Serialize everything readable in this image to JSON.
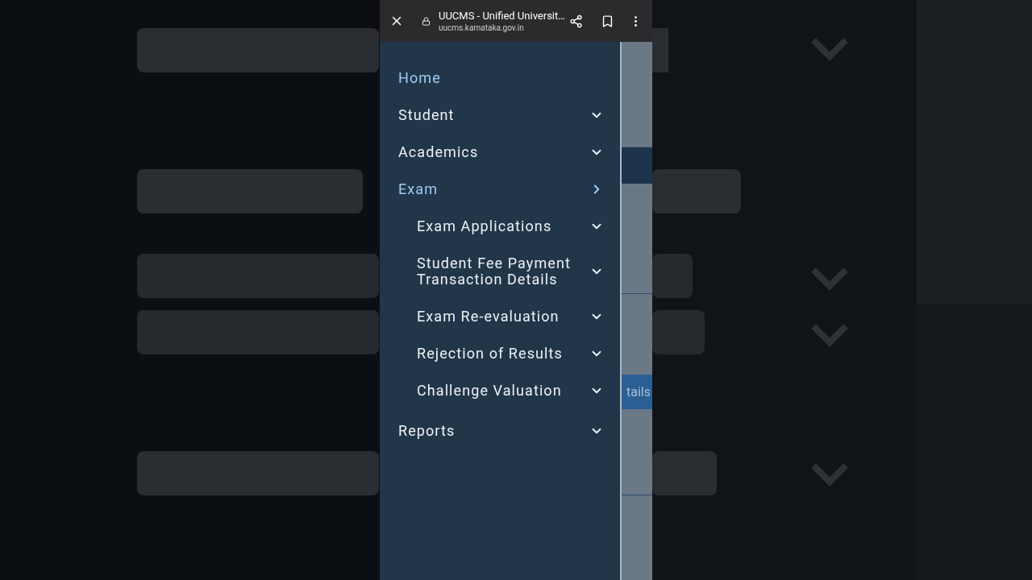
{
  "browser_bar": {
    "title": "UUCMS - Unified Universit…",
    "url": "uucms.karnataka.gov.in"
  },
  "menu": [
    {
      "label": "Home",
      "selected": true,
      "has_submenu": false,
      "expanded": false
    },
    {
      "label": "Student",
      "selected": false,
      "has_submenu": true,
      "expanded": false
    },
    {
      "label": "Academics",
      "selected": false,
      "has_submenu": true,
      "expanded": false
    },
    {
      "label": "Exam",
      "selected": true,
      "has_submenu": true,
      "expanded": true,
      "children": [
        {
          "label": "Exam Applications",
          "selected": false,
          "has_submenu": true,
          "expanded": false
        },
        {
          "label": "Student Fee Payment Transaction Details",
          "selected": false,
          "has_submenu": true,
          "expanded": false
        },
        {
          "label": "Exam Re-evaluation",
          "selected": false,
          "has_submenu": true,
          "expanded": false
        },
        {
          "label": "Rejection of Results",
          "selected": false,
          "has_submenu": true,
          "expanded": false
        },
        {
          "label": "Challenge Valuation",
          "selected": false,
          "has_submenu": true,
          "expanded": false
        }
      ]
    },
    {
      "label": "Reports",
      "selected": false,
      "has_submenu": true,
      "expanded": false
    }
  ],
  "page_behind": {
    "button_text": "tails"
  }
}
